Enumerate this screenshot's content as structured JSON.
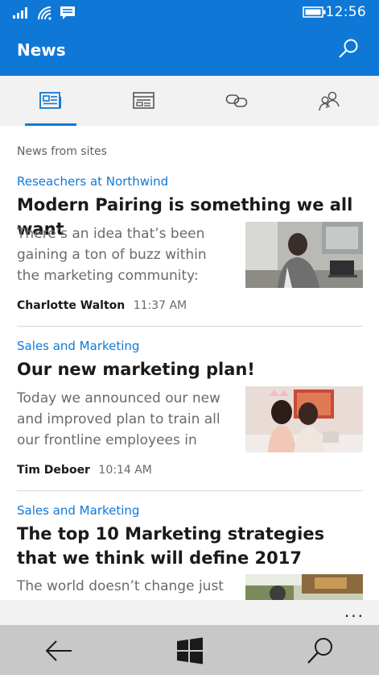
{
  "status_bar": {
    "time": "12:56",
    "icons": [
      "signal-icon",
      "wifi-icon",
      "message-icon",
      "battery-icon"
    ]
  },
  "app": {
    "title": "News"
  },
  "tabs": [
    {
      "name": "news-tab",
      "icon": "newspaper-icon",
      "selected": true
    },
    {
      "name": "sites-tab",
      "icon": "site-page-icon",
      "selected": false
    },
    {
      "name": "links-tab",
      "icon": "link-icon",
      "selected": false
    },
    {
      "name": "people-tab",
      "icon": "people-icon",
      "selected": false
    }
  ],
  "section_title": "News from sites",
  "articles": [
    {
      "category": "Reseachers at Northwind",
      "headline": "Modern Pairing is something we all want",
      "snippet": "There’s an idea that’s been gaining a ton of buzz within the marketing community: Moder...",
      "author": "Charlotte Walton",
      "time": "11:37 AM"
    },
    {
      "category": "Sales and Marketing",
      "headline": "Our new marketing plan!",
      "snippet": "Today we announced our new and improved plan to train all our frontline employees in mo...",
      "author": "Tim Deboer",
      "time": "10:14 AM"
    },
    {
      "category": "Sales and Marketing",
      "headline": "The top 10 Marketing strategies that we think will define 2017",
      "snippet": "The world doesn’t change just"
    }
  ],
  "more_button": "...",
  "colors": {
    "accent": "#0f78d7",
    "tab_bar": "#f2f2f2",
    "nav_bar": "#c8c8c8"
  }
}
